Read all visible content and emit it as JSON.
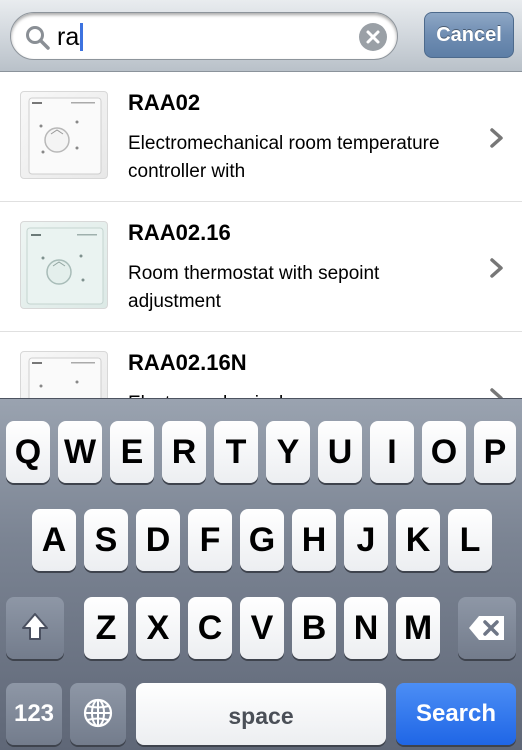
{
  "search": {
    "query": "ra",
    "cancel_label": "Cancel"
  },
  "results": [
    {
      "title": "RAA02",
      "description": "Electromechanical room temperature controller with"
    },
    {
      "title": "RAA02.16",
      "description": "Room thermostat with sepoint adjustment"
    },
    {
      "title": "RAA02.16N",
      "description": "Electromechanical room"
    }
  ],
  "keyboard": {
    "row1": [
      "Q",
      "W",
      "E",
      "R",
      "T",
      "Y",
      "U",
      "I",
      "O",
      "P"
    ],
    "row2": [
      "A",
      "S",
      "D",
      "F",
      "G",
      "H",
      "J",
      "K",
      "L"
    ],
    "row3": [
      "Z",
      "X",
      "C",
      "V",
      "B",
      "N",
      "M"
    ],
    "numbers_label": "123",
    "space_label": "space",
    "search_label": "Search"
  },
  "icons": {
    "search": "search-icon",
    "clear": "clear-icon",
    "chevron": "chevron-right-icon",
    "shift": "shift-icon",
    "backspace": "backspace-icon",
    "globe": "globe-icon"
  },
  "colors": {
    "cancel_button": "#6f8db2",
    "search_key": "#1f66e6",
    "caret": "#3d73e0"
  }
}
